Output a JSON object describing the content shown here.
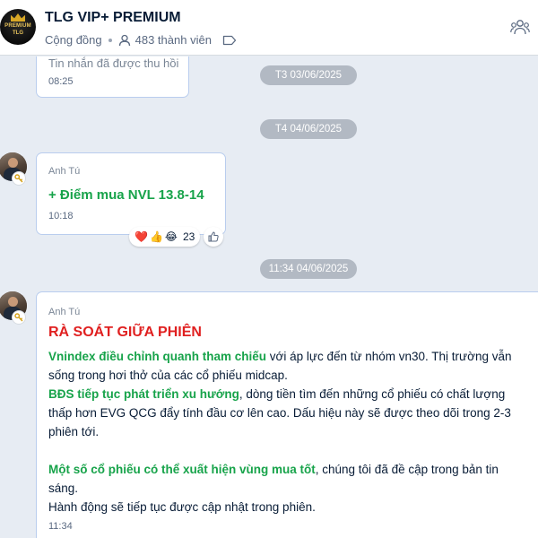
{
  "header": {
    "group_name": "TLG VIP+ PREMIUM",
    "avatar_line1": "PREMIUM",
    "avatar_line2": "TLG",
    "community_label": "Cộng đồng",
    "members": "483 thành viên"
  },
  "messages": {
    "recalled": {
      "text": "Tin nhắn đã được thu hồi",
      "time": "08:25"
    },
    "sep1": "T3 03/06/2025",
    "sep2": "T4 04/06/2025",
    "msg1": {
      "sender": "Anh Tú",
      "text": "+ Điểm mua NVL 13.8-14",
      "time": "10:18",
      "reactions": {
        "emoji1": "❤️",
        "emoji2": "👍",
        "emoji3": "😂",
        "count": "23"
      }
    },
    "sep3": "11:34 04/06/2025",
    "msg2": {
      "sender": "Anh Tú",
      "heading": "RÀ SOÁT GIỮA PHIÊN",
      "p1_bold": "Vnindex điều chỉnh quanh tham chiếu",
      "p1_rest": " với áp lực đến từ nhóm vn30. Thị trường vẫn sống trong hơi thở của các cổ phiếu midcap.",
      "p2_bold": "BĐS tiếp tục phát triển xu hướng",
      "p2_rest": ", dòng tiền tìm đến những cổ phiếu có chất lượng thấp hơn EVG QCG đẩy tính đầu cơ lên cao. Dấu hiệu này sẽ được theo dõi trong 2-3 phiên tới.",
      "p3_bold": "Một số cổ phiếu có thể xuất hiện vùng mua tốt",
      "p3_rest": ", chúng tôi đã đề cập trong bản tin sáng.",
      "p4": "Hành động sẽ tiếp tục được cập nhật trong phiên.",
      "time": "11:34"
    }
  },
  "colors": {
    "accent_green": "#17a34a",
    "heading_red": "#e02020",
    "bubble_border": "#b9cdee",
    "chat_bg": "#e7ecf3"
  }
}
